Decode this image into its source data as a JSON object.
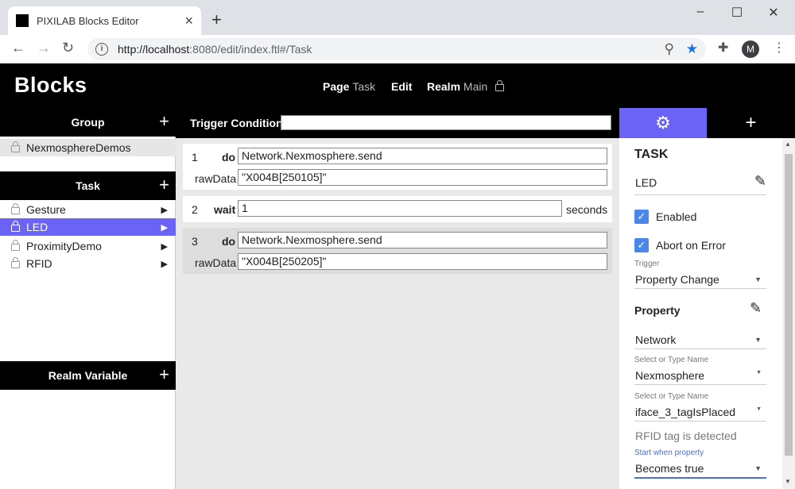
{
  "browser": {
    "tab_title": "PIXILAB Blocks Editor",
    "url_host": "http://localhost",
    "url_rest": ":8080/edit/index.ftl#/Task",
    "avatar_letter": "M"
  },
  "app": {
    "logo": "Blocks",
    "nav": {
      "page_label": "Page",
      "page_value": "Task",
      "edit_label": "Edit",
      "realm_label": "Realm",
      "realm_value": "Main"
    }
  },
  "sidebar": {
    "group_header": "Group",
    "groups": [
      {
        "label": "NexmosphereDemos"
      }
    ],
    "task_header": "Task",
    "tasks": [
      {
        "label": "Gesture",
        "selected": false
      },
      {
        "label": "LED",
        "selected": true
      },
      {
        "label": "ProximityDemo",
        "selected": false
      },
      {
        "label": "RFID",
        "selected": false
      }
    ],
    "realm_variable_header": "Realm Variable"
  },
  "editor": {
    "trigger_label": "Trigger Condition:",
    "trigger_value": "",
    "blocks": [
      {
        "num": "1",
        "keyword": "do",
        "value": "Network.Nexmosphere.send",
        "arg_label": "rawData",
        "arg_value": "\"X004B[250105]\""
      },
      {
        "num": "2",
        "keyword": "wait",
        "value": "1",
        "suffix": "seconds"
      },
      {
        "num": "3",
        "keyword": "do",
        "value": "Network.Nexmosphere.send",
        "arg_label": "rawData",
        "arg_value": "\"X004B[250205]\""
      }
    ]
  },
  "panel": {
    "title": "TASK",
    "task_name": "LED",
    "enabled_label": "Enabled",
    "enabled": true,
    "abort_label": "Abort on Error",
    "abort": true,
    "trigger_caption": "Trigger",
    "trigger_value": "Property Change",
    "property_heading": "Property",
    "property_source": "Network",
    "select_caption_1": "Select or Type Name",
    "select_value_1": "Nexmosphere",
    "select_caption_2": "Select or Type Name",
    "select_value_2": "iface_3_tagIsPlaced",
    "property_description": "RFID tag is detected",
    "start_caption": "Start when property",
    "start_value": "Becomes true"
  }
}
